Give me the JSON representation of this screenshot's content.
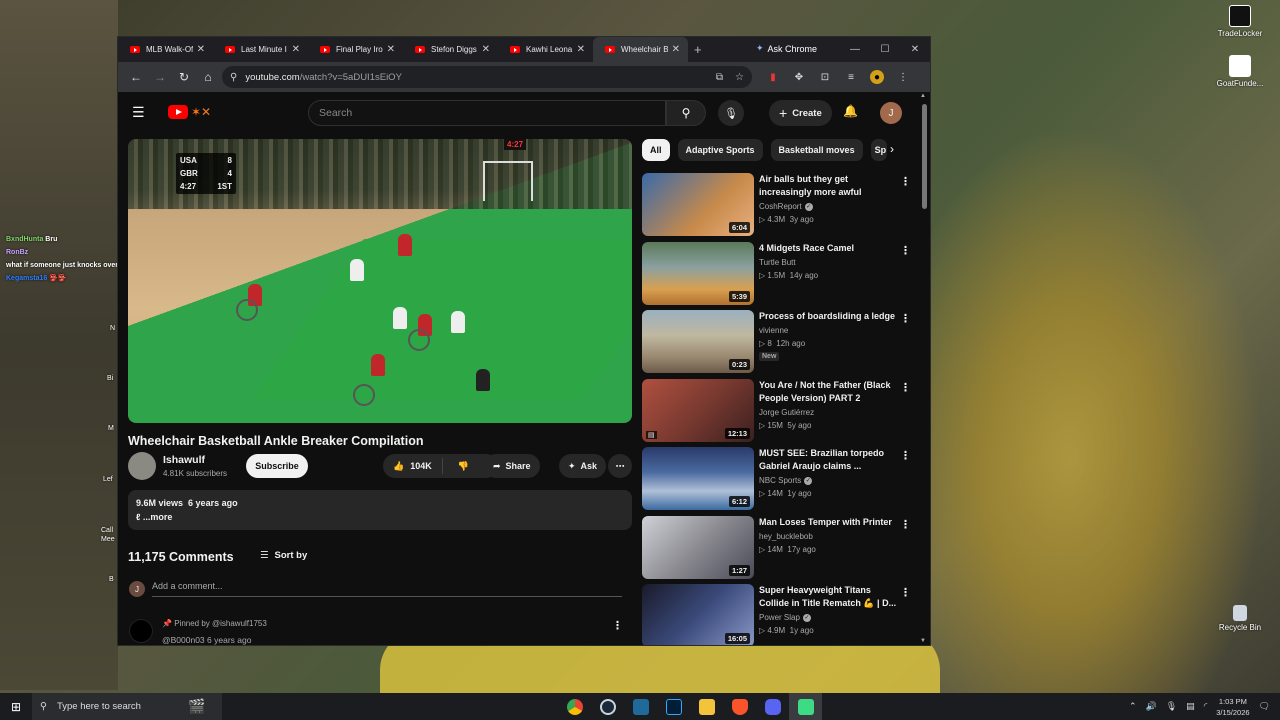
{
  "desktop": {
    "icons": [
      {
        "label": "TradeLocker"
      },
      {
        "label": "GoatFunde..."
      },
      {
        "label": "Recycle Bin"
      }
    ],
    "fragments": [
      "N",
      "Bi",
      "M",
      "Lef",
      "Call\nMee",
      "B"
    ]
  },
  "chat_overlay": [
    {
      "user": "BxndHunta",
      "text": "Bru",
      "color": "#7fd46a"
    },
    {
      "user": "RonBz",
      "text": "what if someone just knocks over their wheel chair is it a foul?",
      "color": "#c7a2ff"
    },
    {
      "user": "Kegamsta16",
      "text": "👺👺",
      "color": "#2d7dff"
    }
  ],
  "browser": {
    "tabs": [
      {
        "title": "MLB Walk-Of",
        "active": false
      },
      {
        "title": "Last Minute I",
        "active": false
      },
      {
        "title": "Final Play Iro",
        "active": false
      },
      {
        "title": "Stefon Diggs",
        "active": false
      },
      {
        "title": "Kawhi Leona",
        "active": false
      },
      {
        "title": "Wheelchair B",
        "active": true
      }
    ],
    "ask_chrome": "Ask Chrome",
    "url_host": "youtube.com",
    "url_path": "/watch?v=5aDUI1sEiOY"
  },
  "youtube": {
    "search_placeholder": "Search",
    "create_label": "Create",
    "avatar_letter": "J",
    "video": {
      "title": "Wheelchair Basketball Ankle Breaker Compilation",
      "channel": "Ishawulf",
      "subscribers": "4.81K subscribers",
      "subscribe_label": "Subscribe",
      "likes": "104K",
      "share_label": "Share",
      "ask_label": "Ask",
      "views": "9.6M views",
      "age": "6 years ago",
      "desc_more": "...more",
      "scorebug": [
        {
          "team": "USA",
          "score": "8"
        },
        {
          "team": "GBR",
          "score": "4"
        },
        {
          "team": "4:27",
          "score": "1ST"
        }
      ],
      "shot_clock": "4:27"
    },
    "comments": {
      "count_label": "11,175 Comments",
      "sort_label": "Sort by",
      "add_placeholder": "Add a comment...",
      "pinned_label": "Pinned by @ishawulf1753",
      "pinned_user": "@B000n03",
      "pinned_age": "6 years ago"
    },
    "chips": [
      {
        "label": "All",
        "selected": true
      },
      {
        "label": "Adaptive Sports",
        "selected": false
      },
      {
        "label": "Basketball moves",
        "selected": false
      },
      {
        "label": "Sp",
        "selected": false
      }
    ],
    "recommendations": [
      {
        "title": "Air balls but they get increasingly more awful",
        "channel": "CoshReport",
        "verified": true,
        "views": "4.3M",
        "age": "3y ago",
        "duration": "6:04",
        "new": false,
        "thumb_color": "#c88a4a"
      },
      {
        "title": "4 Midgets Race Camel",
        "channel": "Turtle Butt",
        "verified": false,
        "views": "1.5M",
        "age": "14y ago",
        "duration": "5:39",
        "new": false,
        "thumb_color": "#d8a050"
      },
      {
        "title": "Process of boardsliding a ledge",
        "channel": "vivienne",
        "verified": false,
        "views": "8",
        "age": "12h ago",
        "duration": "0:23",
        "new": true,
        "new_label": "New",
        "thumb_color": "#9a8870"
      },
      {
        "title": "You Are / Not the Father (Black People Version) PART 2",
        "channel": "Jorge Gutiérrez",
        "verified": false,
        "views": "15M",
        "age": "5y ago",
        "duration": "12:13",
        "new": false,
        "thumb_color": "#7a3a30"
      },
      {
        "title": "MUST SEE: Brazilian torpedo Gabriel Araujo claims ...",
        "channel": "NBC Sports",
        "verified": true,
        "views": "14M",
        "age": "1y ago",
        "duration": "6:12",
        "new": false,
        "thumb_color": "#4a6aa0"
      },
      {
        "title": "Man Loses Temper with Printer",
        "channel": "hey_bucklebob",
        "verified": false,
        "views": "14M",
        "age": "17y ago",
        "duration": "1:27",
        "new": false,
        "thumb_color": "#8a8a90"
      },
      {
        "title": "Super Heavyweight Titans Collide in Title Rematch 💪 | D...",
        "channel": "Power Slap",
        "verified": true,
        "views": "4.9M",
        "age": "1y ago",
        "duration": "16:05",
        "new": false,
        "thumb_color": "#3a4a7a"
      }
    ]
  },
  "taskbar": {
    "search_placeholder": "Type here to search",
    "time": "1:03 PM",
    "date": "3/15/2026"
  },
  "colors": {
    "yt_red": "#ff0000",
    "yt_bg": "#0f0f0f",
    "chip_bg": "#272727"
  }
}
